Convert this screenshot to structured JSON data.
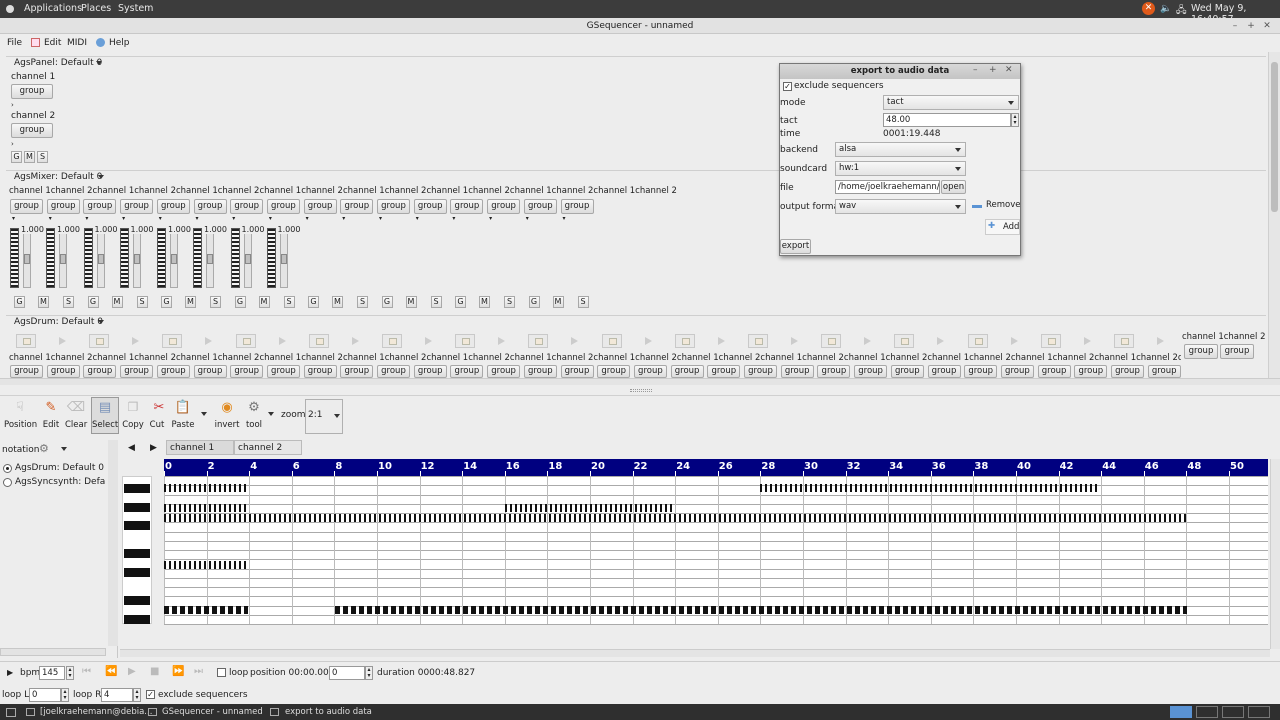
{
  "topbar": {
    "applications": "Applications",
    "places": "Places",
    "system": "System",
    "clock": "Wed May 9, 16:40:57"
  },
  "window": {
    "title": "GSequencer - unnamed"
  },
  "menu": {
    "file": "File",
    "edit": "Edit",
    "midi": "MIDI",
    "help": "Help"
  },
  "panel": {
    "title": "AgsPanel: Default 0",
    "channel1": "channel 1",
    "channel2": "channel 2",
    "group": "group",
    "g": "G",
    "m": "M",
    "s": "S"
  },
  "mixer": {
    "title": "AgsMixer: Default 0",
    "channel_header": "channel 1channel 2channel 1channel 2channel 1channel 2channel 1channel 2channel 1channel 2channel 1channel 2channel 1channel 2channel 1channel 2",
    "group": "group",
    "volume": "1.000",
    "g": "G",
    "m": "M",
    "s": "S"
  },
  "drum": {
    "title": "AgsDrum: Default 0",
    "channel_header": "channel 1channel 2channel 1channel 2channel 1channel 2channel 1channel 2channel 1channel 2channel 1channel 2channel 1channel 2channel 1channel 2channel 1channel 2channel 1channel 2channel 1channel 2channel 1channel 2channel 1channel 2channel 1channel 2channel 1channel 2channel 1channel 2",
    "side_header": "channel 1channel 2",
    "group": "group"
  },
  "dialog": {
    "title": "export to audio data",
    "exclude_sequencers": "exclude sequencers",
    "mode_label": "mode",
    "mode_value": "tact",
    "tact_label": "tact",
    "tact_value": "48.00",
    "time_label": "time",
    "time_value": "0001:19.448",
    "backend_label": "backend",
    "backend_value": "alsa",
    "soundcard_label": "soundcard",
    "soundcard_value": "hw:1",
    "file_label": "file",
    "file_value": "/home/joelkraehemann/sc",
    "open": "open",
    "remove": "Remove",
    "output_format_label": "output format",
    "output_format_value": "wav",
    "add": "Add",
    "export": "export"
  },
  "toolbar": {
    "position": "Position",
    "edit": "Edit",
    "clear": "Clear",
    "select": "Select",
    "copy": "Copy",
    "cut": "Cut",
    "paste": "Paste",
    "invert": "invert",
    "tool": "tool",
    "zoom_label": "zoom",
    "zoom_value": "2:1"
  },
  "editor": {
    "notation": "notation",
    "machine1": "AgsDrum: Default 0",
    "machine2": "AgsSyncsynth: Default 0",
    "tab1": "channel 1",
    "tab2": "channel 2",
    "ruler": [
      "0",
      "2",
      "4",
      "6",
      "8",
      "10",
      "12",
      "14",
      "16",
      "18",
      "20",
      "22",
      "24",
      "26",
      "28",
      "30",
      "32",
      "34",
      "36",
      "38",
      "40",
      "42",
      "44",
      "46",
      "48",
      "50"
    ]
  },
  "transport": {
    "bpm_label": "bpm",
    "bpm_value": "145",
    "loop": "loop",
    "position_label": "position 00:00.000",
    "position_value": "0",
    "duration": "duration 0000:48.827",
    "loop_l_label": "loop L",
    "loop_l_value": "0",
    "loop_r_label": "loop R",
    "loop_r_value": "4",
    "exclude_sequencers": "exclude sequencers"
  },
  "taskbar": {
    "item1": "[joelkraehemann@debia...",
    "item2": "GSequencer - unnamed",
    "item3": "export to audio data"
  },
  "colors": {
    "accent": "#5a93d4",
    "ruler_bg": "#000080",
    "close": "#e05a1a"
  }
}
